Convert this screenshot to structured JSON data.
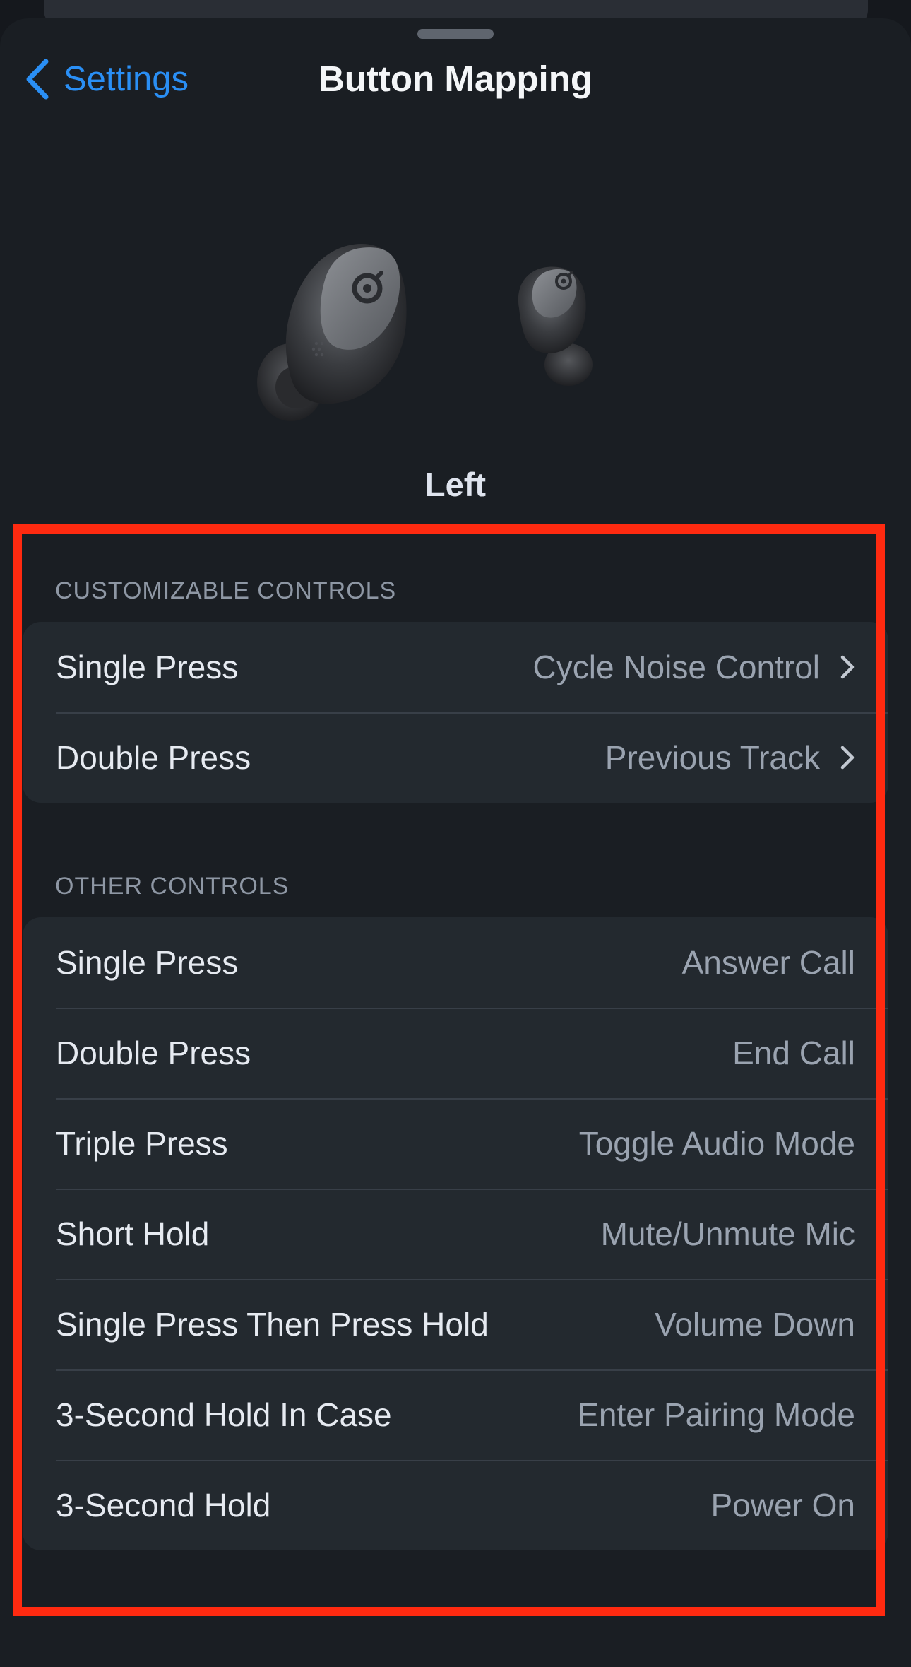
{
  "nav": {
    "back_label": "Settings",
    "title": "Button Mapping"
  },
  "device": {
    "side_label": "Left"
  },
  "customizable": {
    "header": "CUSTOMIZABLE CONTROLS",
    "rows": [
      {
        "label": "Single Press",
        "value": "Cycle Noise Control"
      },
      {
        "label": "Double Press",
        "value": "Previous Track"
      }
    ]
  },
  "other": {
    "header": "OTHER CONTROLS",
    "rows": [
      {
        "label": "Single Press",
        "value": "Answer Call"
      },
      {
        "label": "Double Press",
        "value": "End Call"
      },
      {
        "label": "Triple Press",
        "value": "Toggle Audio Mode"
      },
      {
        "label": "Short Hold",
        "value": "Mute/Unmute Mic"
      },
      {
        "label": "Single Press Then Press Hold",
        "value": "Volume Down"
      },
      {
        "label": "3-Second Hold In Case",
        "value": "Enter Pairing Mode"
      },
      {
        "label": "3-Second Hold",
        "value": "Power On"
      }
    ]
  },
  "colors": {
    "accent": "#2a8ff5",
    "background": "#1a1e23",
    "group_background": "#23292f",
    "highlight_border": "#ff2a10"
  },
  "icons": {
    "back": "chevron-left-icon",
    "disclosure": "chevron-right-icon"
  }
}
